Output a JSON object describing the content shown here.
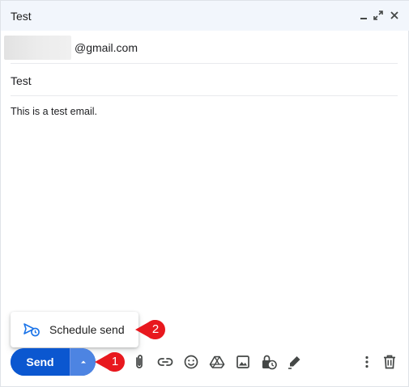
{
  "window": {
    "title": "Test"
  },
  "recipient": {
    "visible_suffix": "@gmail.com"
  },
  "subject": {
    "value": "Test"
  },
  "message": {
    "body": "This is a test email."
  },
  "popup": {
    "label": "Schedule send",
    "icon": "schedule-send-icon"
  },
  "send": {
    "label": "Send",
    "more_icon": "caret-up-icon"
  },
  "callouts": [
    {
      "number": "1"
    },
    {
      "number": "2"
    }
  ],
  "toolbar": {
    "icons": [
      "attach-icon",
      "link-icon",
      "emoji-icon",
      "drive-icon",
      "photo-icon",
      "confidential-icon",
      "signature-icon",
      "more-options-icon",
      "trash-icon"
    ]
  },
  "colors": {
    "send_blue": "#0b57d0",
    "send_more_blue": "#4d84e2",
    "callout_red": "#e8181e",
    "header_bg": "#f2f6fc"
  }
}
